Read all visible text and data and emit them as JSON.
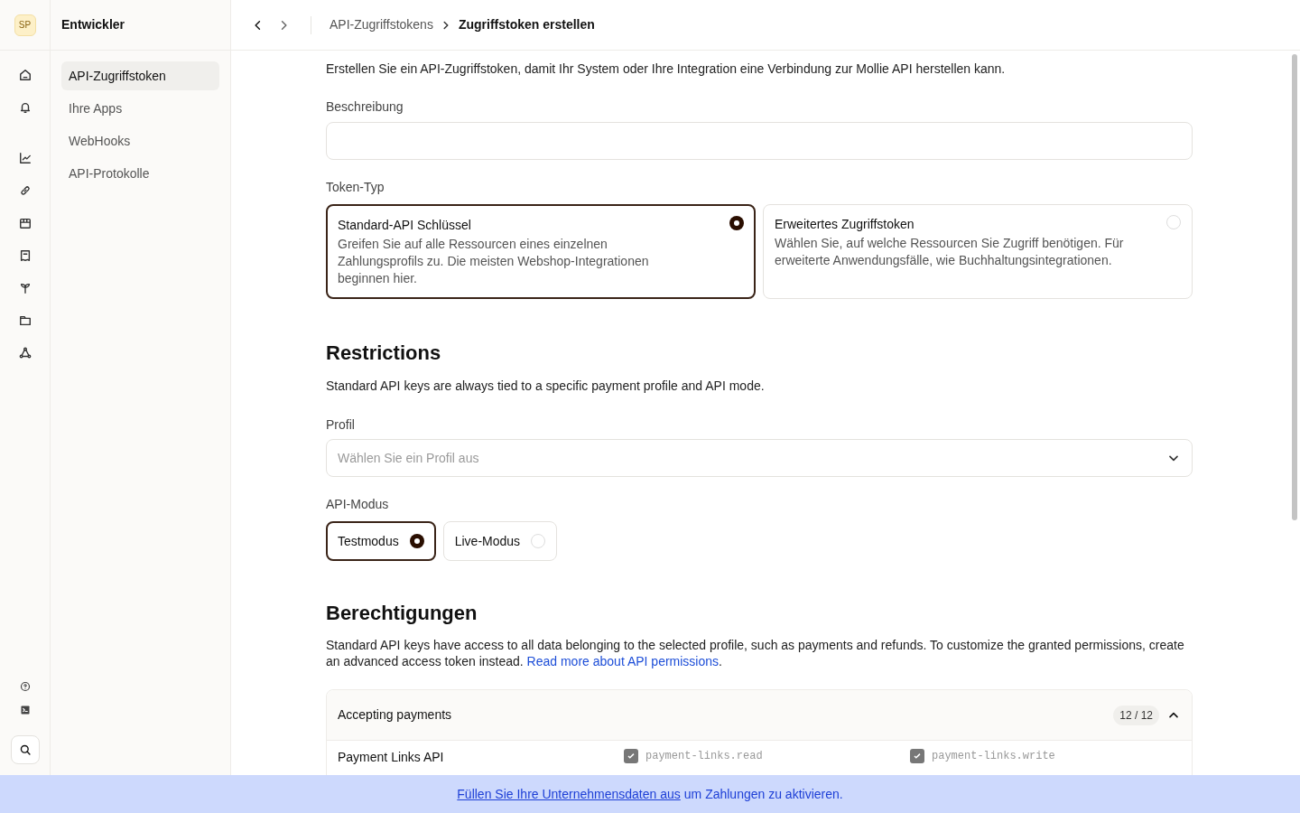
{
  "rail": {
    "avatar": "SP"
  },
  "sidebar": {
    "title": "Entwickler",
    "items": [
      {
        "label": "API-Zugriffstoken",
        "selected": true
      },
      {
        "label": "Ihre Apps",
        "selected": false
      },
      {
        "label": "WebHooks",
        "selected": false
      },
      {
        "label": "API-Protokolle",
        "selected": false
      }
    ]
  },
  "breadcrumb": [
    "API-Zugriffstokens",
    "Zugriffstoken erstellen"
  ],
  "intro": "Erstellen Sie ein API-Zugriffstoken, damit Ihr System oder Ihre Integration eine Verbindung zur Mollie API herstellen kann.",
  "description_field": {
    "label": "Beschreibung"
  },
  "token_type": {
    "label": "Token-Typ",
    "options": [
      {
        "title": "Standard-API Schlüssel",
        "text": "Greifen Sie auf alle Ressourcen eines einzelnen Zahlungsprofils zu. Die meisten Webshop-Integrationen beginnen hier.",
        "selected": true
      },
      {
        "title": "Erweitertes Zugriffstoken",
        "text": "Wählen Sie, auf welche Ressourcen Sie Zugriff benötigen. Für erweiterte Anwendungsfälle, wie Buchhaltungsintegrationen.",
        "selected": false
      }
    ]
  },
  "restrictions": {
    "heading": "Restrictions",
    "text": "Standard API keys are always tied to a specific payment profile and API mode.",
    "profile": {
      "label": "Profil",
      "placeholder": "Wählen Sie ein Profil aus"
    },
    "mode": {
      "label": "API-Modus",
      "options": [
        {
          "label": "Testmodus",
          "selected": true
        },
        {
          "label": "Live-Modus",
          "selected": false
        }
      ]
    }
  },
  "permissions": {
    "heading": "Berechtigungen",
    "text": "Standard API keys have access to all data belonging to the selected profile, such as payments and refunds. To customize the granted permissions, create an advanced access token instead.",
    "link": "Read more about API permissions",
    "after_link": ".",
    "groups": [
      {
        "title": "Accepting payments",
        "count": "12 / 12",
        "expanded": true,
        "rows": [
          {
            "name": "Payment Links API",
            "scopes": [
              {
                "label": "payment-links.read",
                "checked": true
              },
              {
                "label": "payment-links.write",
                "checked": true
              }
            ]
          }
        ]
      }
    ]
  },
  "banner": {
    "link": "Füllen Sie Ihre Unternehmensdaten aus",
    "text": "um Zahlungen zu aktivieren."
  }
}
